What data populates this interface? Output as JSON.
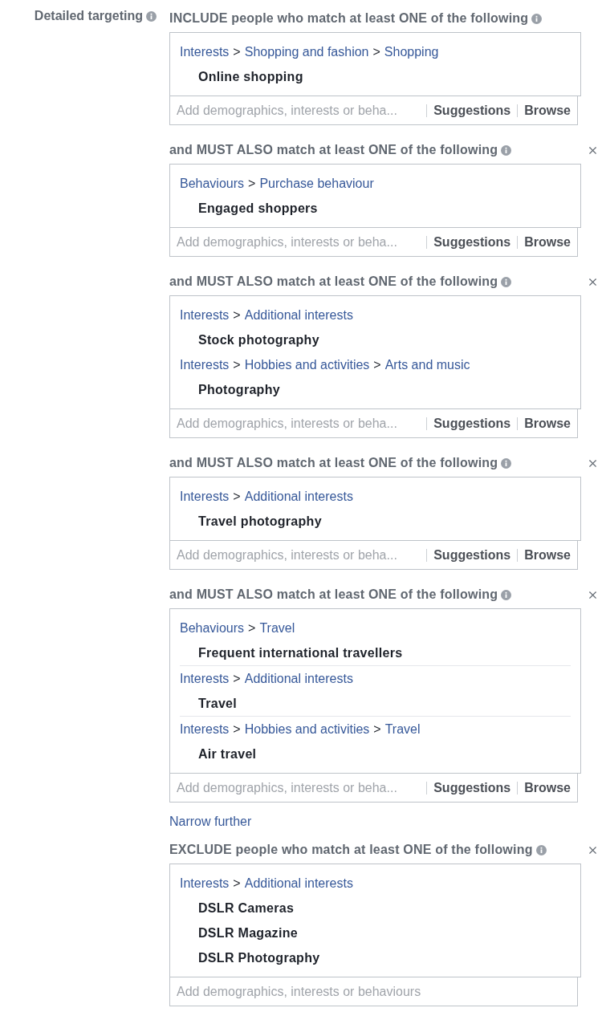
{
  "label": "Detailed targeting",
  "separator": ">",
  "sections": [
    {
      "heading": "INCLUDE people who match at least ONE of the following",
      "closable": false,
      "groups": [
        {
          "path": [
            "Interests",
            "Shopping and fashion",
            "Shopping"
          ],
          "items": [
            "Online shopping"
          ]
        }
      ],
      "field": {
        "placeholder": "Add demographics, interests or beha...",
        "buttons": [
          "Suggestions",
          "Browse"
        ]
      }
    },
    {
      "heading": "and MUST ALSO match at least ONE of the following",
      "closable": true,
      "groups": [
        {
          "path": [
            "Behaviours",
            "Purchase behaviour"
          ],
          "items": [
            "Engaged shoppers"
          ]
        }
      ],
      "field": {
        "placeholder": "Add demographics, interests or beha...",
        "buttons": [
          "Suggestions",
          "Browse"
        ]
      }
    },
    {
      "heading": "and MUST ALSO match at least ONE of the following",
      "closable": true,
      "groups": [
        {
          "path": [
            "Interests",
            "Additional interests"
          ],
          "items": [
            "Stock photography"
          ]
        },
        {
          "path": [
            "Interests",
            "Hobbies and activities",
            "Arts and music"
          ],
          "items": [
            "Photography"
          ],
          "divider": false
        }
      ],
      "field": {
        "placeholder": "Add demographics, interests or beha...",
        "buttons": [
          "Suggestions",
          "Browse"
        ]
      }
    },
    {
      "heading": "and MUST ALSO match at least ONE of the following",
      "closable": true,
      "groups": [
        {
          "path": [
            "Interests",
            "Additional interests"
          ],
          "items": [
            "Travel photography"
          ]
        }
      ],
      "field": {
        "placeholder": "Add demographics, interests or beha...",
        "buttons": [
          "Suggestions",
          "Browse"
        ]
      }
    },
    {
      "heading": "and MUST ALSO match at least ONE of the following",
      "closable": true,
      "groups": [
        {
          "path": [
            "Behaviours",
            "Travel"
          ],
          "items": [
            "Frequent international travellers"
          ]
        },
        {
          "path": [
            "Interests",
            "Additional interests"
          ],
          "items": [
            "Travel"
          ],
          "divider": true
        },
        {
          "path": [
            "Interests",
            "Hobbies and activities",
            "Travel"
          ],
          "items": [
            "Air travel"
          ],
          "divider": true
        }
      ],
      "field": {
        "placeholder": "Add demographics, interests or beha...",
        "buttons": [
          "Suggestions",
          "Browse"
        ]
      }
    }
  ],
  "narrow_link": "Narrow further",
  "exclude": {
    "heading": "EXCLUDE people who match at least ONE of the following",
    "closable": true,
    "groups": [
      {
        "path": [
          "Interests",
          "Additional interests"
        ],
        "items": [
          "DSLR Cameras",
          "DSLR Magazine",
          "DSLR Photography"
        ]
      }
    ],
    "field": {
      "placeholder": "Add demographics, interests or behaviours"
    }
  }
}
